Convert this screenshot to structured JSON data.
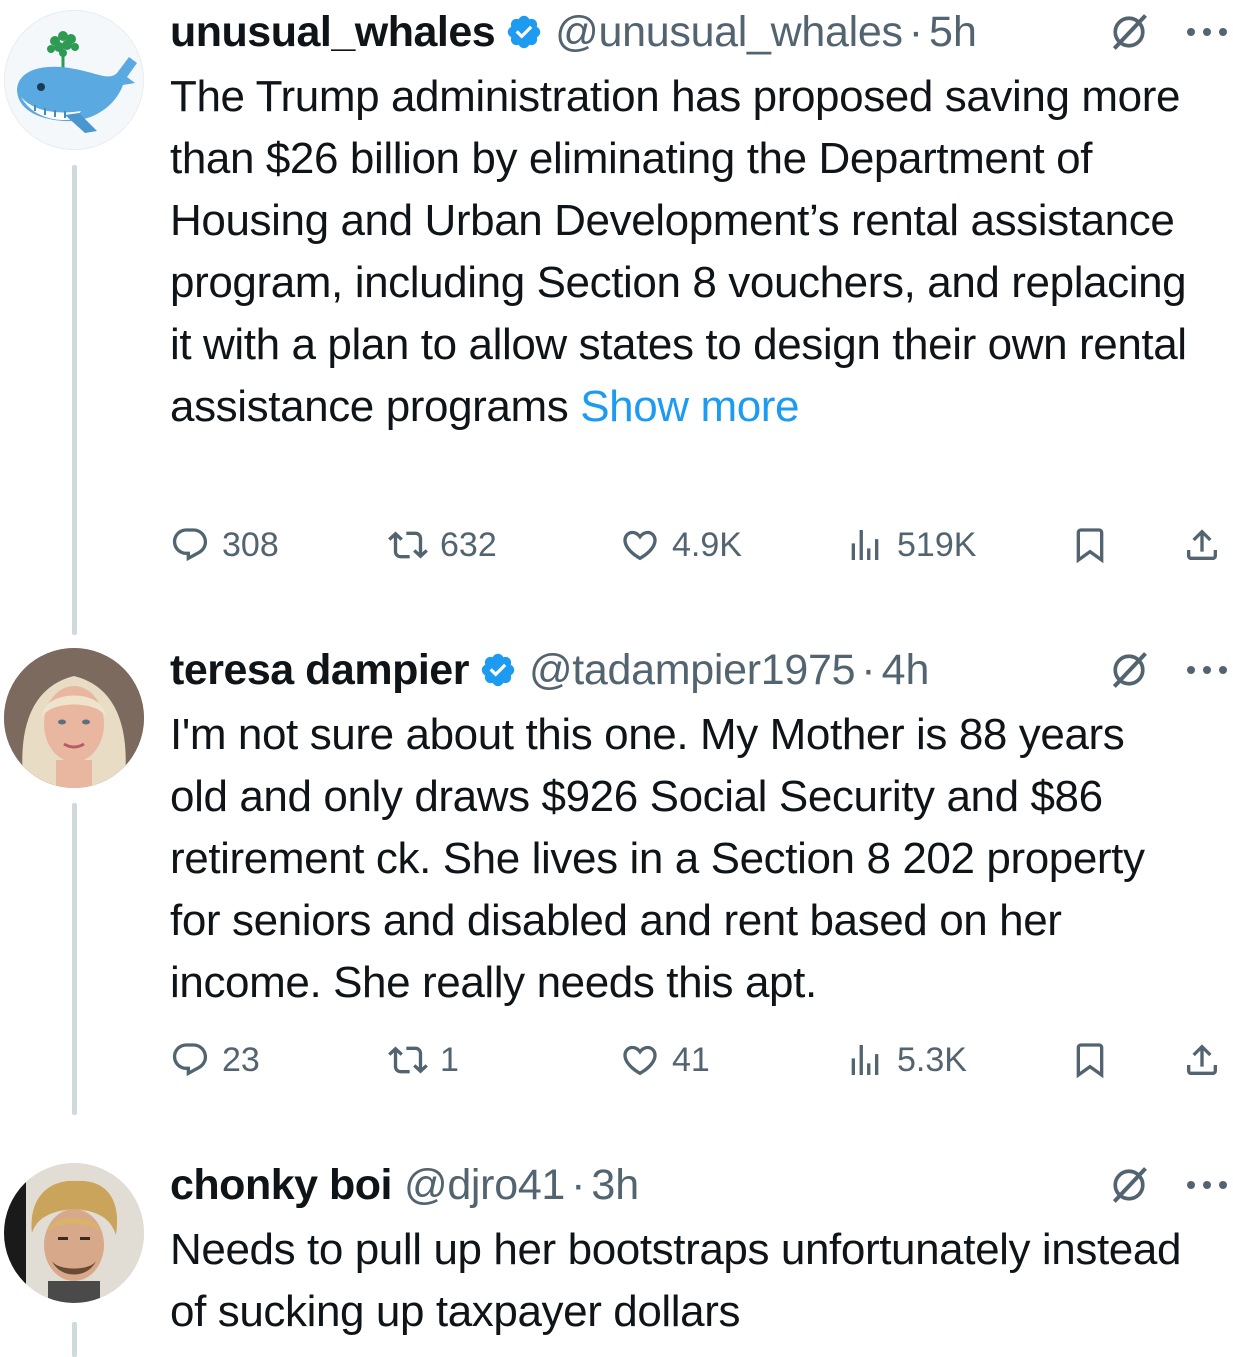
{
  "posts": [
    {
      "name": "unusual_whales",
      "handle": "@unusual_whales",
      "separator": "·",
      "time": "5h",
      "text": "The Trump administration has proposed saving more than $26 billion by eliminating the Department of Housing and Urban Development’s rental assistance program, including Section 8 vouchers, and replacing it with a plan to allow states to design their own rental assistance programs ",
      "show_more": "Show more",
      "replies": "308",
      "reposts": "632",
      "likes": "4.9K",
      "views": "519K"
    },
    {
      "name": "teresa dampier",
      "handle": "@tadampier1975",
      "separator": "·",
      "time": "4h",
      "text": "I'm not sure about this one. My Mother is 88 years old and only draws $926 Social Security and $86 retirement ck. She lives in a Section 8 202 property for seniors and disabled and rent based on her income.  She really needs this apt.",
      "replies": "23",
      "reposts": "1",
      "likes": "41",
      "views": "5.3K"
    },
    {
      "name": "chonky boi",
      "handle": "@djro41",
      "separator": "·",
      "time": "3h",
      "text": "Needs to pull up her bootstraps unfortunately instead of sucking up taxpayer dollars"
    }
  ],
  "colors": {
    "text": "#0f1419",
    "secondary": "#536471",
    "link": "#1d9bf0",
    "verified": "#1d9bf0",
    "thread_line": "#cfd9de"
  },
  "icons": [
    "reply-icon",
    "repost-icon",
    "like-icon",
    "views-icon",
    "bookmark-icon",
    "share-icon",
    "grok-icon",
    "more-icon",
    "verified-badge-icon"
  ]
}
